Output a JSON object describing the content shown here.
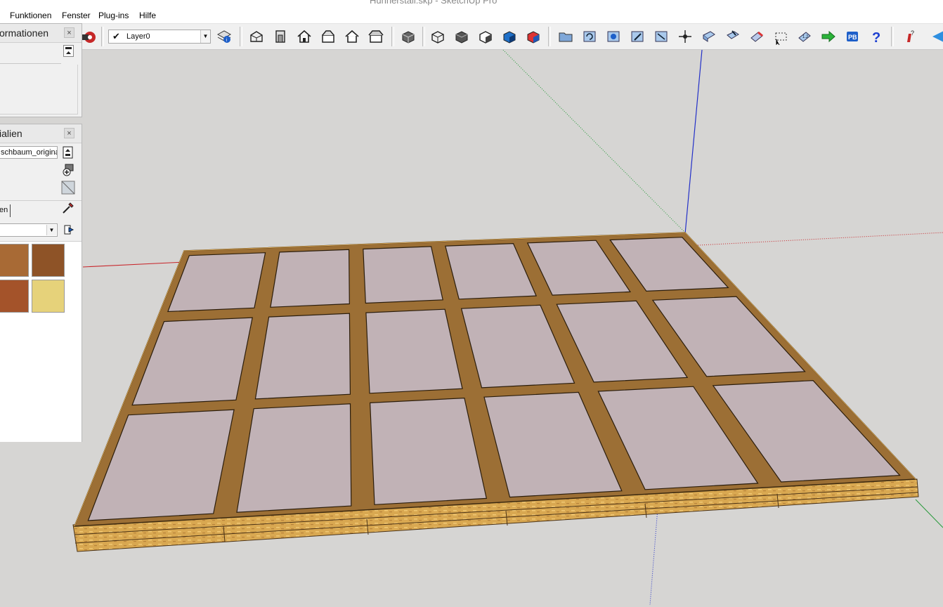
{
  "window": {
    "title": "Hühnerstall.skp - SketchUp Pro"
  },
  "menu": {
    "items": [
      "Funktionen",
      "Fenster",
      "Plug-ins",
      "Hilfe"
    ]
  },
  "layer": {
    "current": "Layer0"
  },
  "entity_info": {
    "title": "ormationen",
    "close": "×"
  },
  "materials": {
    "title": "ialien",
    "close": "×",
    "material_name": "schbaum_origina",
    "tab_label": "en",
    "swatches": [
      {
        "name": "wood-medium",
        "color": "#a86a35"
      },
      {
        "name": "wood-planks",
        "color": "#8e5327"
      },
      {
        "name": "wood-reddish",
        "color": "#a4532a"
      },
      {
        "name": "wood-light",
        "color": "#e6d27a"
      }
    ]
  },
  "scene": {
    "panel_color": "#c1b2b6",
    "timber_color": "#9c6f35",
    "edge_color": "#d6a452",
    "axis_colors": {
      "red": "#c8262b",
      "green": "#2a9a3c",
      "blue": "#2330c8"
    }
  }
}
